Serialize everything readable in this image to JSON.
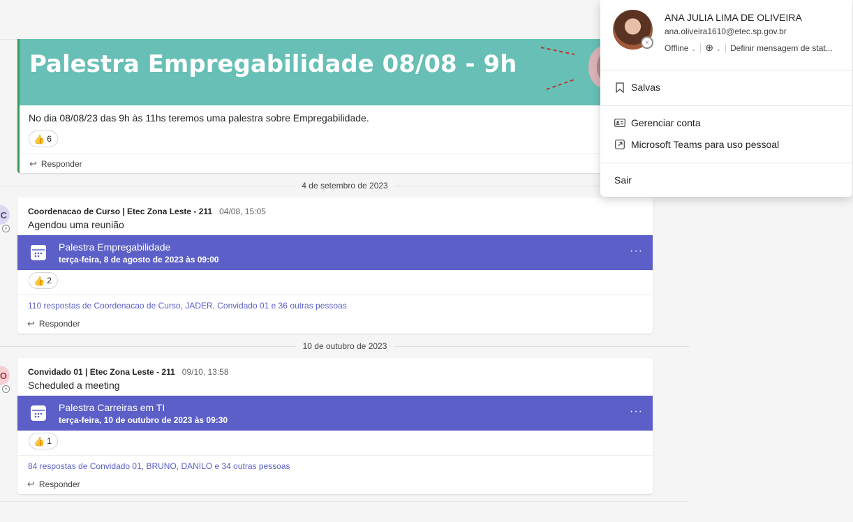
{
  "post1": {
    "banner_title": "Palestra Empregabilidade 08/08 - 9h",
    "body": "No dia 08/08/23 das 9h às 11hs teremos uma palestra sobre Empregabilidade.",
    "reaction_count": "6",
    "reply_label": "Responder"
  },
  "sep1": {
    "label": "4 de setembro de 2023"
  },
  "post2": {
    "avatar_initial": "C",
    "author": "Coordenacao de Curso | Etec Zona Leste - 211",
    "time": "04/08, 15:05",
    "message": "Agendou uma reunião",
    "meeting_title": "Palestra Empregabilidade",
    "meeting_date": "terça-feira, 8 de agosto de 2023 às 09:00",
    "reaction_count": "2",
    "replies": "110 respostas de Coordenacao de Curso, JADER, Convidado 01 e 36 outras pessoas",
    "reply_label": "Responder"
  },
  "sep2": {
    "label": "10 de outubro de 2023"
  },
  "post3": {
    "avatar_initial": "O",
    "author": "Convidado 01 | Etec Zona Leste - 211",
    "time": "09/10, 13:58",
    "message": "Scheduled a meeting",
    "meeting_title": "Palestra Carreiras em TI",
    "meeting_date": "terça-feira, 10 de outubro de 2023 às 09:30",
    "reaction_count": "1",
    "replies": "84 respostas de Convidado 01, BRUNO, DANILO e 34 outras pessoas",
    "reply_label": "Responder"
  },
  "profile": {
    "name": "ANA JULIA LIMA DE OLIVEIRA",
    "email": "ana.oliveira1610@etec.sp.gov.br",
    "status": "Offline",
    "status_message": "Definir mensagem de stat...",
    "items": {
      "saved": "Salvas",
      "manage_account": "Gerenciar conta",
      "teams_personal": "Microsoft Teams para uso pessoal",
      "sign_out": "Sair"
    }
  },
  "colors": {
    "meeting_bar": "#5b5fc7",
    "banner": "#67bfb5",
    "accent_link": "#5b5fc7",
    "post_accent": "#3a9a5a"
  },
  "icons": [
    "thumbs-up-icon",
    "reply-arrow-icon",
    "calendar-icon",
    "more-options-icon",
    "bookmark-icon",
    "contact-card-icon",
    "external-link-icon",
    "add-status-icon",
    "presence-offline-icon",
    "megaphone-icon"
  ]
}
